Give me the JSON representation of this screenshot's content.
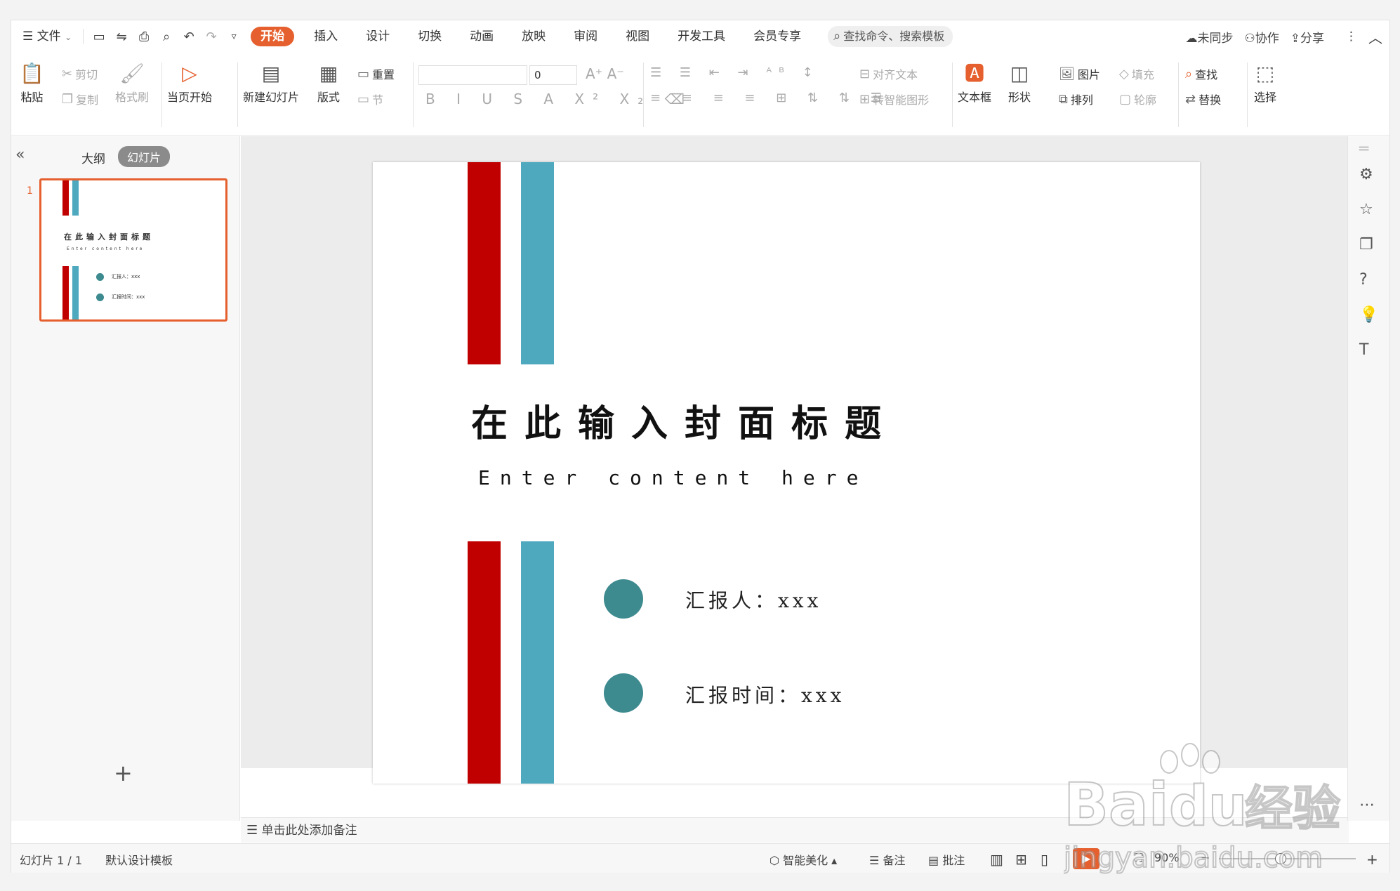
{
  "menubar": {
    "file_label": "文件",
    "tabs": [
      "开始",
      "插入",
      "设计",
      "切换",
      "动画",
      "放映",
      "审阅",
      "视图",
      "开发工具",
      "会员专享"
    ],
    "search_placeholder": "查找命令、搜索模板",
    "sync_label": "未同步",
    "collab_label": "协作",
    "share_label": "分享"
  },
  "ribbon": {
    "paste": "粘贴",
    "cut": "剪切",
    "copy": "复制",
    "format_painter": "格式刷",
    "start_from_current": "当页开始",
    "new_slide": "新建幻灯片",
    "layout": "版式",
    "reset": "重置",
    "section": "节",
    "font_size_value": "0",
    "align_text": "对齐文本",
    "smart_shape": "转智能图形",
    "text_box": "文本框",
    "shape": "形状",
    "picture": "图片",
    "fill": "填充",
    "arrange": "排列",
    "outline": "轮廓",
    "find": "查找",
    "replace": "替换",
    "select": "选择"
  },
  "left_panel": {
    "tab_outline": "大纲",
    "tab_slides": "幻灯片",
    "slide_number": "1",
    "thumb_title": "在此输入封面标题",
    "thumb_sub": "Enter content here",
    "thumb_reporter": "汇报人：xxx",
    "thumb_time": "汇报时间：xxx"
  },
  "slide": {
    "title": "在此输入封面标题",
    "subtitle": "Enter content here",
    "reporter": "汇报人：xxx",
    "report_time": "汇报时间：xxx",
    "colors": {
      "red": "#c00000",
      "teal": "#4ea9bf",
      "dot": "#3d8a8f"
    }
  },
  "notes": {
    "placeholder": "单击此处添加备注"
  },
  "statusbar": {
    "slide_count": "幻灯片 1 / 1",
    "template": "默认设计模板",
    "beautify": "智能美化",
    "notes": "备注",
    "comments": "批注",
    "zoom": "90%"
  },
  "watermark": {
    "brand": "Bai",
    "brand2": "经验",
    "url": "jingyan.baidu.com"
  }
}
